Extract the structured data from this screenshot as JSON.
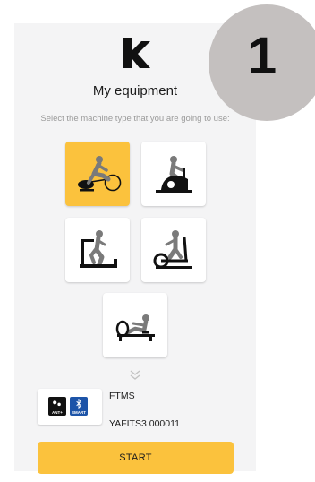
{
  "header": {
    "logo_icon": "brand-logo-icon",
    "title": "My equipment",
    "subtitle": "Select the machine type that you are going to use:"
  },
  "machines": [
    {
      "type": "bike",
      "icon": "bike-icon",
      "selected": true
    },
    {
      "type": "spin-bike",
      "icon": "spin-bike-icon",
      "selected": false
    },
    {
      "type": "treadmill",
      "icon": "treadmill-icon",
      "selected": false
    },
    {
      "type": "elliptical",
      "icon": "elliptical-icon",
      "selected": false
    },
    {
      "type": "rower",
      "icon": "rower-icon",
      "selected": false
    }
  ],
  "device": {
    "ant_label": "ANT+",
    "bt_label": "SMART",
    "name": "FTMS",
    "id": "YAFITS3 000011"
  },
  "start_label": "START",
  "step_number": "1",
  "colors": {
    "accent": "#fbc23d",
    "panel": "#f4f4f5",
    "step_circle": "#c4c0bf",
    "subtitle": "#9a9a9a",
    "bluetooth": "#1d54a8"
  }
}
